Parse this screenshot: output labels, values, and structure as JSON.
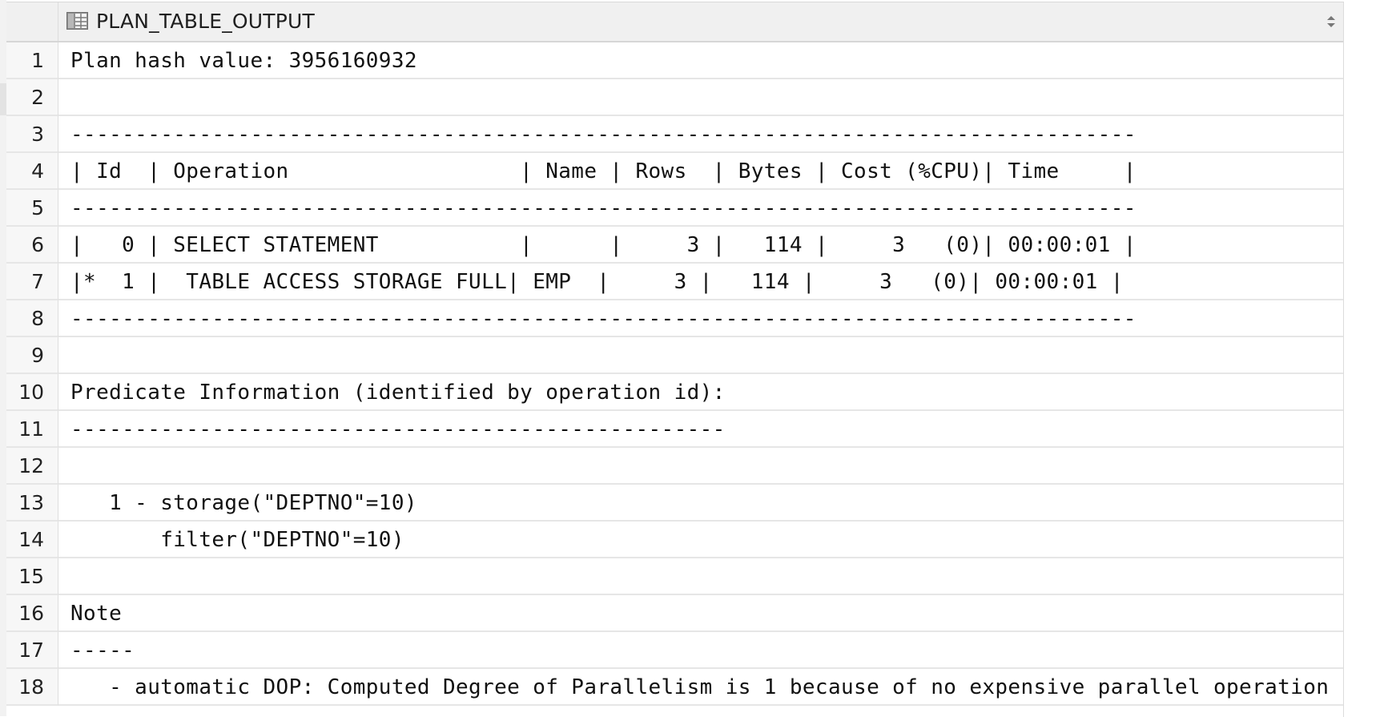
{
  "result_grid": {
    "column": {
      "name": "PLAN_TABLE_OUTPUT",
      "icon": "table-column-icon",
      "sort_icon": "sort-icon"
    },
    "rows": [
      {
        "line": "1",
        "text": "Plan hash value: 3956160932"
      },
      {
        "line": "2",
        "text": ""
      },
      {
        "line": "3",
        "text": "-----------------------------------------------------------------------------------"
      },
      {
        "line": "4",
        "text": "| Id  | Operation                  | Name | Rows  | Bytes | Cost (%CPU)| Time     |"
      },
      {
        "line": "5",
        "text": "-----------------------------------------------------------------------------------"
      },
      {
        "line": "6",
        "text": "|   0 | SELECT STATEMENT           |      |     3 |   114 |     3   (0)| 00:00:01 |"
      },
      {
        "line": "7",
        "text": "|*  1 |  TABLE ACCESS STORAGE FULL| EMP  |     3 |   114 |     3   (0)| 00:00:01 |"
      },
      {
        "line": "8",
        "text": "-----------------------------------------------------------------------------------"
      },
      {
        "line": "9",
        "text": ""
      },
      {
        "line": "10",
        "text": "Predicate Information (identified by operation id):"
      },
      {
        "line": "11",
        "text": "---------------------------------------------------"
      },
      {
        "line": "12",
        "text": ""
      },
      {
        "line": "13",
        "text": "   1 - storage(\"DEPTNO\"=10)"
      },
      {
        "line": "14",
        "text": "       filter(\"DEPTNO\"=10)"
      },
      {
        "line": "15",
        "text": ""
      },
      {
        "line": "16",
        "text": "Note"
      },
      {
        "line": "17",
        "text": "-----"
      },
      {
        "line": "18",
        "text": "   - automatic DOP: Computed Degree of Parallelism is 1 because of no expensive parallel operation"
      }
    ]
  }
}
